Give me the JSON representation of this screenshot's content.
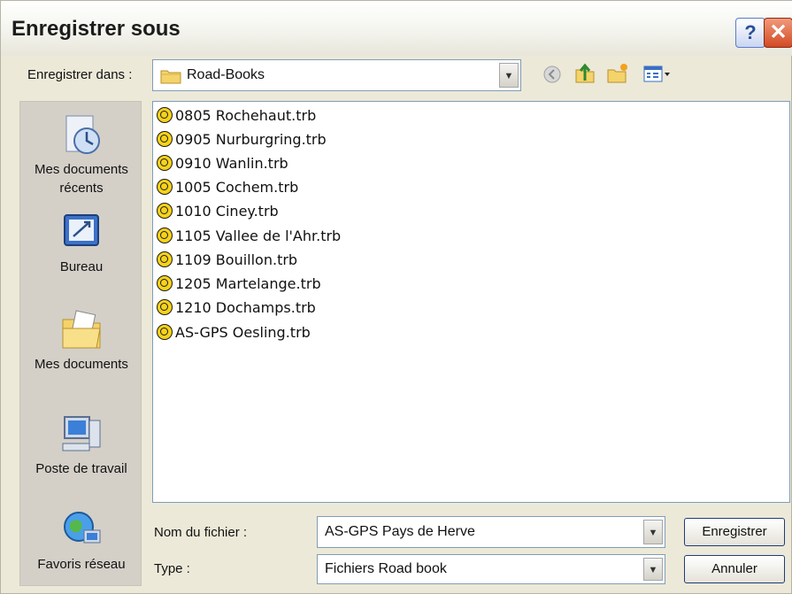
{
  "window": {
    "title": "Enregistrer sous",
    "help_label": "?",
    "close_label": "✕"
  },
  "save_in": {
    "label": "Enregistrer dans :",
    "value": "Road-Books"
  },
  "toolbar": {
    "icons": [
      "back-icon",
      "up-folder-icon",
      "new-folder-icon",
      "view-menu-icon"
    ]
  },
  "places": [
    {
      "label_line1": "Mes documents",
      "label_line2": "récents",
      "icon": "recent-documents-icon"
    },
    {
      "label_line1": "Bureau",
      "icon": "desktop-icon"
    },
    {
      "label_line1": "Mes documents",
      "icon": "my-documents-icon"
    },
    {
      "label_line1": "Poste de travail",
      "icon": "my-computer-icon"
    },
    {
      "label_line1": "Favoris réseau",
      "icon": "network-places-icon"
    }
  ],
  "files": [
    "0805 Rochehaut.trb",
    "0905 Nurburgring.trb",
    "0910 Wanlin.trb",
    "1005 Cochem.trb",
    "1010 Ciney.trb",
    "1105 Vallee de l'Ahr.trb",
    "1109 Bouillon.trb",
    "1205 Martelange.trb",
    "1210 Dochamps.trb",
    "AS-GPS Oesling.trb"
  ],
  "filename": {
    "label": "Nom du fichier :",
    "value": "AS-GPS Pays de Herve"
  },
  "filetype": {
    "label": "Type :",
    "value": "Fichiers Road book"
  },
  "buttons": {
    "save": "Enregistrer",
    "cancel": "Annuler"
  },
  "colors": {
    "file_icon": "#f6d21a",
    "border_blue": "#7f9db9",
    "dialog_bg": "#ece9d8",
    "places_bg": "#d4d0c8"
  }
}
